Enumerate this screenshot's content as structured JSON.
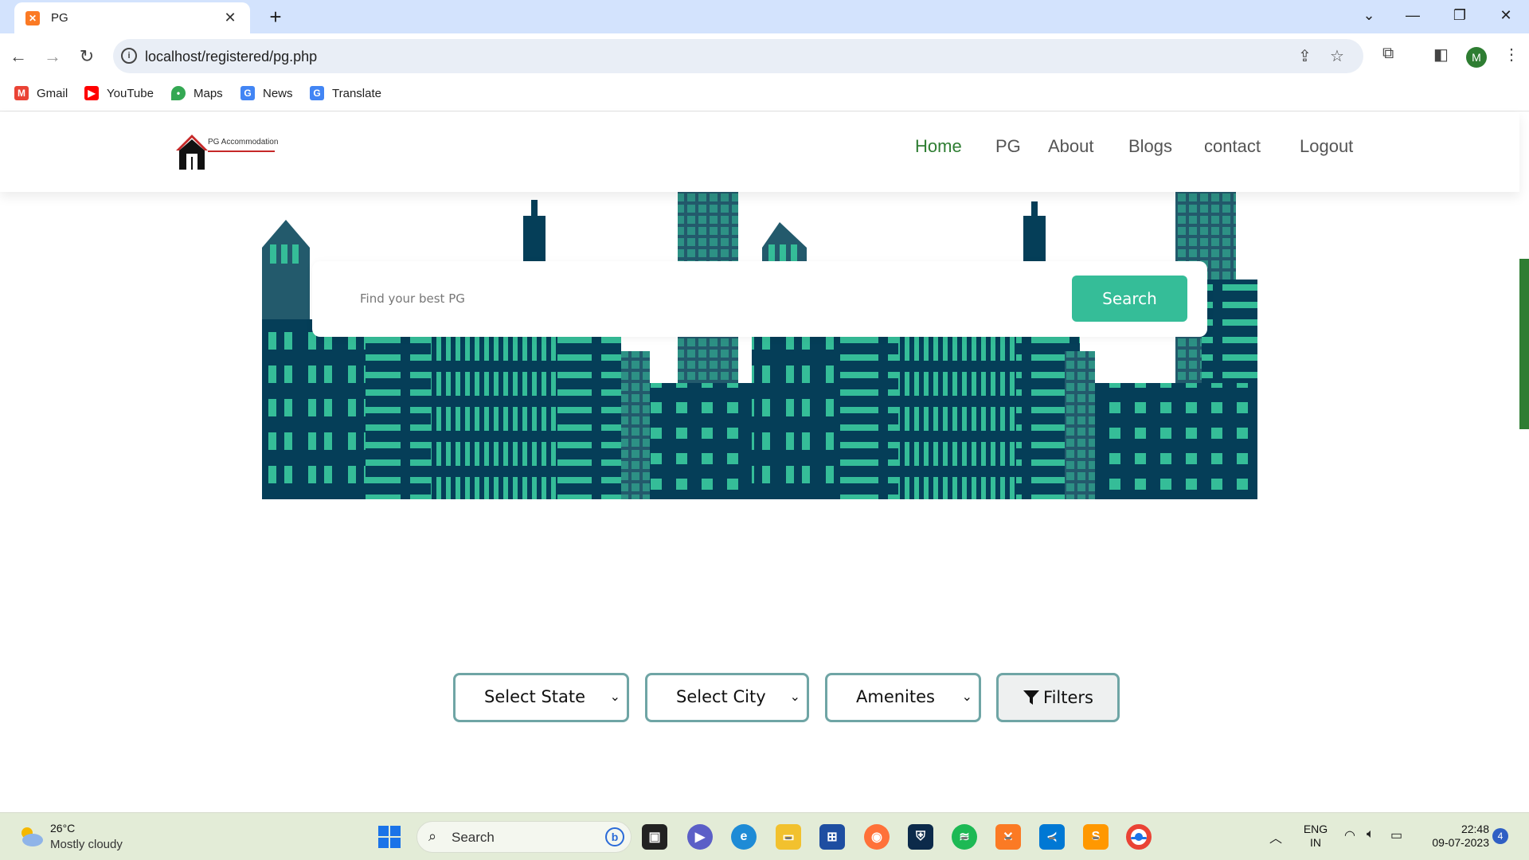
{
  "browser": {
    "tab_title": "PG",
    "url": "localhost/registered/pg.php",
    "profile_initial": "M",
    "bookmarks": [
      {
        "label": "Gmail",
        "icon": "gmail-icon",
        "color": "#ea4335"
      },
      {
        "label": "YouTube",
        "icon": "youtube-icon",
        "color": "#ff0000"
      },
      {
        "label": "Maps",
        "icon": "maps-icon",
        "color": "#34a853"
      },
      {
        "label": "News",
        "icon": "news-icon",
        "color": "#4285f4"
      },
      {
        "label": "Translate",
        "icon": "translate-icon",
        "color": "#4285f4"
      }
    ]
  },
  "site": {
    "logo_text": "PG Accommodation",
    "nav": [
      "Home",
      "PG",
      "About",
      "Blogs",
      "contact",
      "Logout"
    ],
    "active_nav": "Home",
    "search_placeholder": "Find your best PG",
    "search_button": "Search",
    "filters": {
      "state": "Select State",
      "city": "Select City",
      "amenities": "Amenites",
      "button": "Filters"
    },
    "colors": {
      "accent_green": "#2e7d32",
      "search_button": "#35bd98",
      "city_dark": "#053e58",
      "city_mid": "#235a6c",
      "city_window": "#35bd98"
    }
  },
  "taskbar": {
    "temperature": "26°C",
    "weather": "Mostly cloudy",
    "search_label": "Search",
    "language": "ENG",
    "region": "IN",
    "time": "22:48",
    "date": "09-07-2023",
    "notification_count": "4"
  }
}
